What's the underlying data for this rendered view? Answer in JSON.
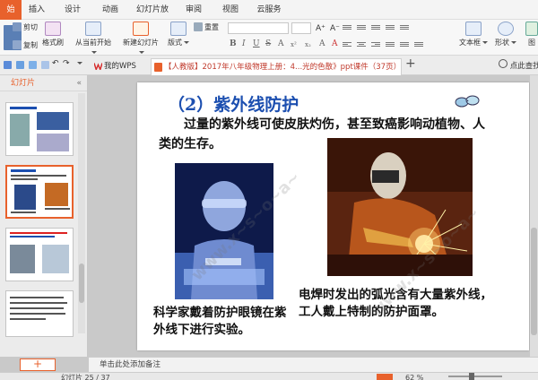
{
  "menu": {
    "tabs": [
      "始",
      "插入",
      "设计",
      "动画",
      "幻灯片放映",
      "审阅",
      "视图",
      "云服务"
    ]
  },
  "ribbon": {
    "cut": "剪切",
    "copy": "复制",
    "format_painter": "格式刷",
    "from_current": "从当前开始",
    "new_slide": "新建幻灯片",
    "layout": "版式",
    "reset": "重置",
    "text_box": "文本框",
    "shapes": "形状",
    "picture": "图"
  },
  "tabstrip": {
    "home_tab": "我的WPS",
    "doc_tab": "【人教版】2017年八年级物理上册：4...光的色散》ppt课件（37页）.ppt",
    "help": "点此查找命"
  },
  "left_panel": {
    "title": "幻灯片",
    "slide_numbers": [
      "",
      "",
      "",
      ""
    ],
    "add_label": "+"
  },
  "slide": {
    "title": "（2）紫外线防护",
    "body": "过量的紫外线可使皮肤灼伤，甚至致癌影响动植物、人类的生存。",
    "caption_left": "科学家戴着防护眼镜在紫外线下进行实验。",
    "caption_right": "电焊时发出的弧光含有大量紫外线，工人戴上特制的防护面罩。"
  },
  "notes": {
    "placeholder": "单击此处添加备注"
  },
  "status": {
    "slide_counter": "幻灯片 25 / 37",
    "zoom": "62 %"
  },
  "colors": {
    "accent": "#e8612c",
    "title_blue": "#1c4fb0"
  },
  "icons": [
    "cut-icon",
    "copy-icon",
    "format-painter-icon",
    "play-icon",
    "new-slide-icon",
    "help-icon",
    "plus-icon",
    "close-icon"
  ]
}
